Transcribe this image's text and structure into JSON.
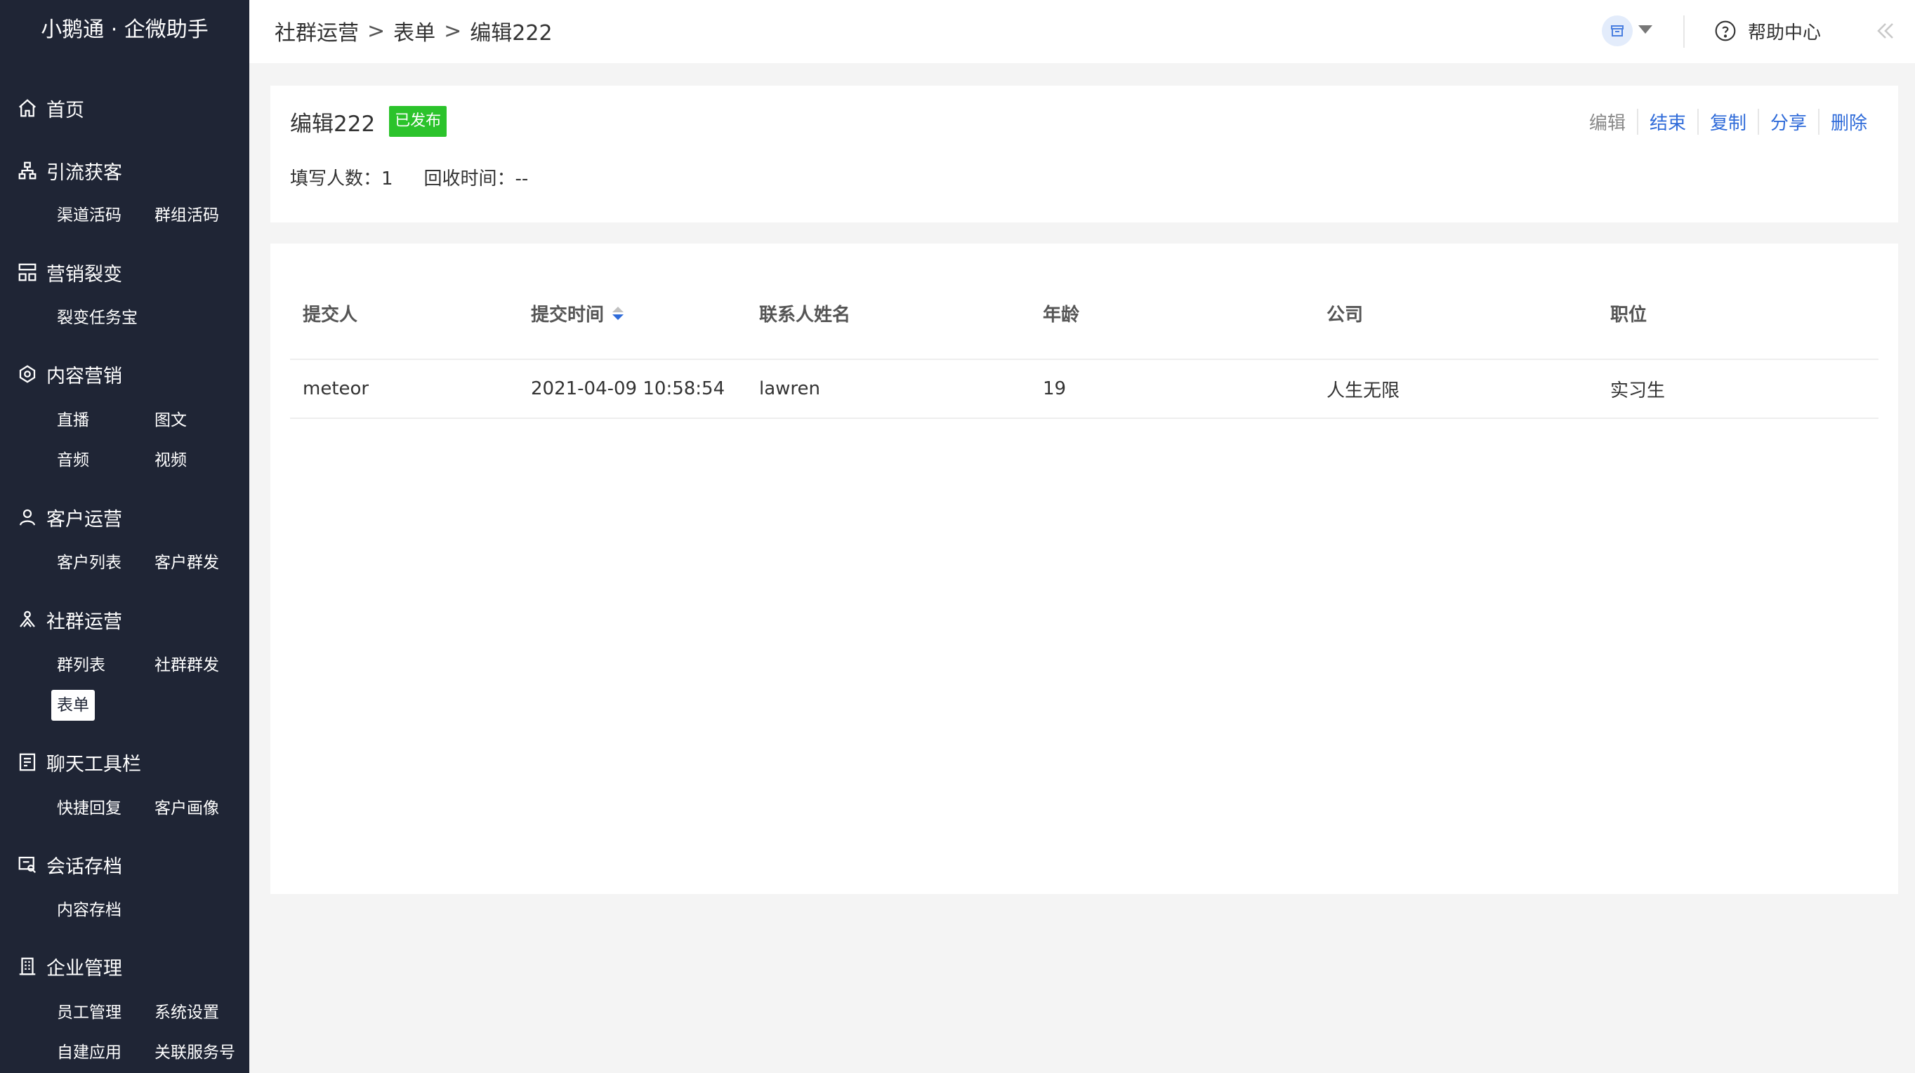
{
  "app": {
    "brand": "小鹅通 · 企微助手"
  },
  "sidebar": {
    "sections": [
      {
        "label": "首页",
        "icon": "home-icon",
        "items": []
      },
      {
        "label": "引流获客",
        "icon": "org-icon",
        "items": [
          "渠道活码",
          "群组活码"
        ]
      },
      {
        "label": "营销裂变",
        "icon": "hierarchy-icon",
        "items": [
          "裂变任务宝"
        ]
      },
      {
        "label": "内容营销",
        "icon": "content-icon",
        "items": [
          "直播",
          "图文",
          "音频",
          "视频"
        ]
      },
      {
        "label": "客户运营",
        "icon": "user-icon",
        "items": [
          "客户列表",
          "客户群发"
        ]
      },
      {
        "label": "社群运营",
        "icon": "community-icon",
        "items": [
          "群列表",
          "社群群发",
          "表单"
        ]
      },
      {
        "label": "聊天工具栏",
        "icon": "toolbar-icon",
        "items": [
          "快捷回复",
          "客户画像"
        ]
      },
      {
        "label": "会话存档",
        "icon": "archive-icon",
        "items": [
          "内容存档"
        ]
      },
      {
        "label": "企业管理",
        "icon": "building-icon",
        "items": [
          "员工管理",
          "系统设置",
          "自建应用",
          "关联服务号"
        ]
      }
    ],
    "active_item": "表单"
  },
  "header": {
    "breadcrumb": [
      "社群运营",
      "表单",
      "编辑222"
    ],
    "separator": ">",
    "help_label": "帮助中心"
  },
  "form_info": {
    "title": "编辑222",
    "status": "已发布",
    "fill_count_label": "填写人数：1",
    "recycle_time_label": "回收时间：--",
    "actions": [
      "编辑",
      "结束",
      "复制",
      "分享",
      "删除"
    ]
  },
  "table": {
    "columns": [
      "提交人",
      "提交时间",
      "联系人姓名",
      "年龄",
      "公司",
      "职位"
    ],
    "rows": [
      [
        "meteor",
        "2021-04-09 10:58:54",
        "lawren",
        "19",
        "人生无限",
        "实习生"
      ]
    ]
  },
  "colors": {
    "sidebar_bg": "#1f2535",
    "accent": "#2f6bd9",
    "badge": "#2bc32b"
  }
}
